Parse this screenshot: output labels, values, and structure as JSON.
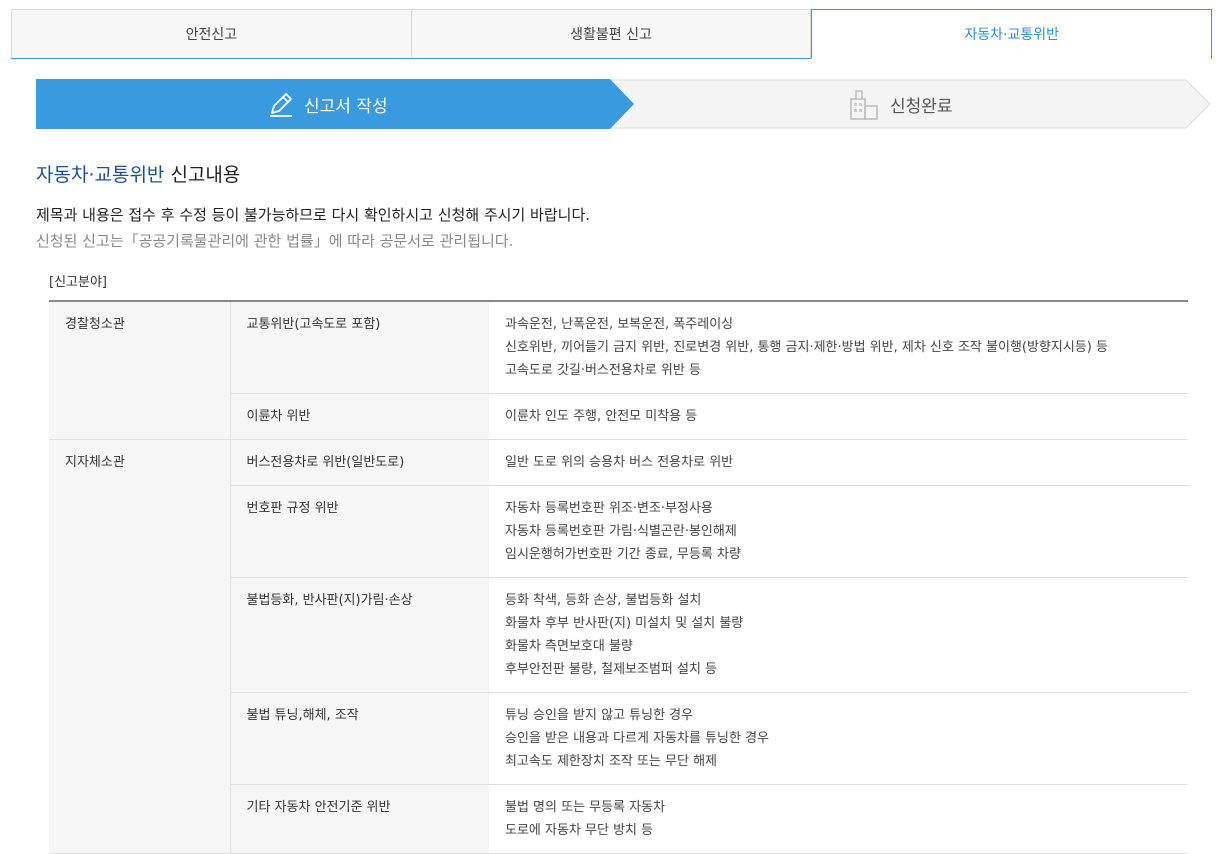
{
  "tabs": [
    "안전신고",
    "생활불편 신고",
    "자동차·교통위반"
  ],
  "steps": {
    "write": "신고서 작성",
    "done": "신청완료"
  },
  "section": {
    "title_highlight": "자동차·교통위반",
    "title_rest": " 신고내용"
  },
  "notice": {
    "line1": "제목과 내용은 접수 후 수정 등이 불가능하므로 다시 확인하시고 신청해 주시기 바랍니다.",
    "line2": "신청된 신고는「공공기록물관리에 관한 법률」에 따라 공문서로 관리됩니다."
  },
  "field_label": "[신고분야]",
  "table": {
    "groups": [
      {
        "org": "경찰청소관",
        "rows": [
          {
            "category": "교통위반(고속도로 포함)",
            "lines": [
              "과속운전, 난폭운전, 보복운전, 폭주레이싱",
              "신호위반, 끼어들기 금지 위반, 진로변경 위반, 통행 금지·제한·방법 위반, 제차 신호 조작 불이행(방향지시등) 등",
              "고속도로 갓길·버스전용차로 위반 등"
            ]
          },
          {
            "category": "이륜차 위반",
            "lines": [
              "이륜차 인도 주행, 안전모 미착용 등"
            ]
          }
        ]
      },
      {
        "org": "지자체소관",
        "rows": [
          {
            "category": "버스전용차로 위반(일반도로)",
            "lines": [
              "일반 도로 위의 승용차 버스 전용차로 위반"
            ]
          },
          {
            "category": "번호판 규정 위반",
            "lines": [
              "자동차 등록번호판 위조·변조·부정사용",
              "자동차 등록번호판 가림·식별곤란·봉인해제",
              "임시운행허가번호판 기간 종료, 무등록 차량"
            ]
          },
          {
            "category": "불법등화, 반사판(지)가림·손상",
            "lines": [
              "등화 착색, 등화 손상, 불법등화 설치",
              "화물차 후부 반사판(지) 미설치 및 설치 불량",
              "화물차 측면보호대 불량",
              "후부안전판 불량, 철제보조범퍼 설치 등"
            ]
          },
          {
            "category": "불법 튜닝,해체, 조작",
            "lines": [
              "튜닝 승인을 받지 않고 튜닝한 경우",
              "승인을 받은 내용과 다르게 자동차를 튜닝한 경우",
              "최고속도 제한장치 조작 또는 무단 해제"
            ]
          },
          {
            "category": "기타 자동차 안전기준 위반",
            "lines": [
              "불법 명의 또는 무등록 자동차",
              "도로에 자동차 무단 방치 등"
            ]
          }
        ]
      }
    ]
  }
}
